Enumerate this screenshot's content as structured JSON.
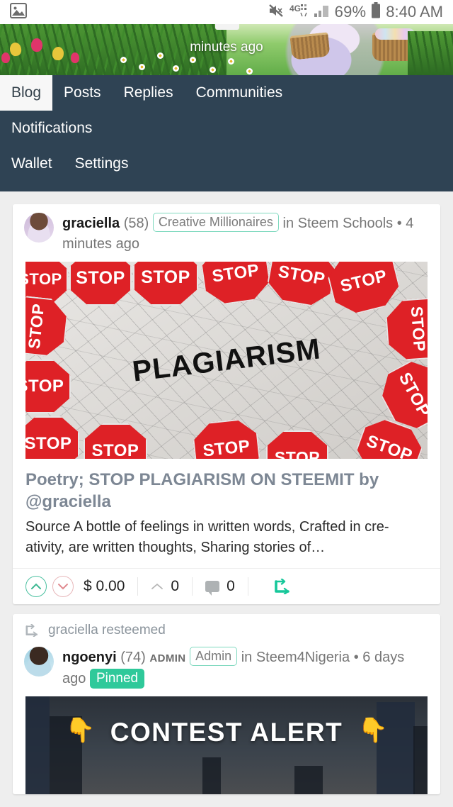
{
  "status_bar": {
    "left_icons": [
      "image-icon"
    ],
    "right_icons": [
      "mute-icon",
      "4g-lte-icon",
      "signal-bars-icon",
      "battery-icon"
    ],
    "network_label": "4G",
    "battery_percent": "69%",
    "time": "8:40 AM"
  },
  "cover": {
    "overlay_text": "minutes ago",
    "description": "spring easter banner with tulips grass daisies and person carrying egg baskets"
  },
  "nav": {
    "row1": [
      {
        "label": "Blog",
        "active": true
      },
      {
        "label": "Posts",
        "active": false
      },
      {
        "label": "Replies",
        "active": false
      },
      {
        "label": "Communities",
        "active": false
      }
    ],
    "row2": [
      {
        "label": "Notifications",
        "active": false
      }
    ],
    "row3": [
      {
        "label": "Wallet",
        "active": false
      },
      {
        "label": "Settings",
        "active": false
      }
    ]
  },
  "posts": [
    {
      "author": "graciella",
      "reputation": "(58)",
      "community_badge": "Creative Millionaires",
      "in_label": "in Steem Schools",
      "separator": "•",
      "age": "4 minutes ago",
      "image_alt": "STOP PLAGIARISM",
      "image_word": "PLAGIARISM",
      "image_sign_label": "STOP",
      "title": "Poetry; STOP PLAGIARISM ON STEEMIT by @graciella",
      "summary": "Source A bottle of feelings in written words, Crafted in cre-ativity, are written thoughts, Sharing stories of…",
      "payout": "$ 0.00",
      "votes": "0",
      "comments": "0",
      "upvote_icon": "chevron-up-icon",
      "downvote_icon": "chevron-down-icon",
      "comment_icon": "speech-bubble-icon",
      "resteem_icon": "resteem-arrow-icon"
    },
    {
      "resteem_label": "graciella resteemed",
      "resteem_icon": "resteem-arrow-icon",
      "author": "ngoenyi",
      "reputation": "(74)",
      "role": "ADMIN",
      "role_badge": "Admin",
      "in_label": "in Steem4Nigeria",
      "separator": "•",
      "age": "6 days ago",
      "pinned_badge": "Pinned",
      "image_alt": "CONTEST ALERT",
      "image_text": "CONTEST ALERT",
      "hand_icon": "pointing-down-hand-icon"
    }
  ],
  "colors": {
    "nav_background": "#2f4354",
    "accent_teal": "#2fc99a",
    "upvote": "#4cc1a1",
    "downvote": "#e8b8bb",
    "page_background": "#eeeeee",
    "title_text": "#7d8794"
  }
}
